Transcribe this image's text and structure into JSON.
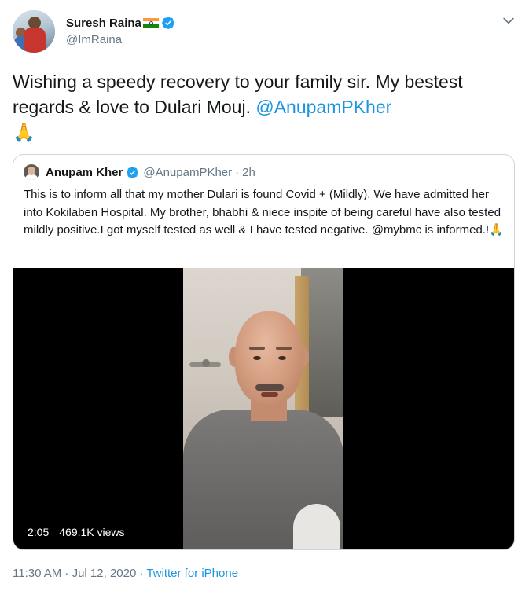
{
  "author": {
    "display_name": "Suresh Raina",
    "handle": "@ImRaina",
    "flag_icon": "india-flag-icon",
    "verified_icon": "verified-badge-icon"
  },
  "tweet": {
    "text_before": "Wishing a speedy recovery to your family sir. My bestest regards & love to Dulari Mouj. ",
    "mention": "@AnupamPKher",
    "emoji": "🙏"
  },
  "quoted": {
    "display_name": "Anupam Kher",
    "handle": "@AnupamPKher",
    "separator": "·",
    "age": "2h",
    "text": "This is to inform all that my mother Dulari is found Covid + (Mildly). We have admitted her into Kokilaben Hospital. My brother, bhabhi & niece inspite of being careful have also tested mildly positive.I got myself tested as well & I have tested negative. @mybmc is informed.!🙏",
    "video": {
      "duration": "2:05",
      "views": "469.1K views"
    }
  },
  "footer": {
    "time": "11:30 AM · Jul 12, 2020",
    "separator": "·",
    "source": "Twitter for iPhone"
  },
  "colors": {
    "link": "#1b95e0",
    "secondary_text": "#657786",
    "border": "#ccd6dd",
    "verified": "#1da1f2"
  }
}
